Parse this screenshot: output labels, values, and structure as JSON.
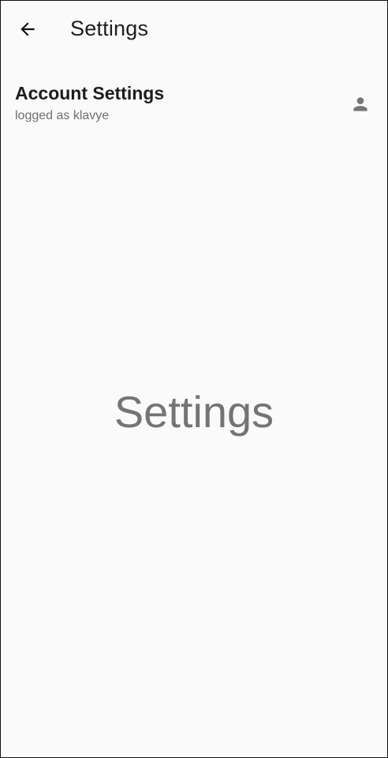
{
  "app_bar": {
    "back_icon": "arrow-back-icon",
    "title": "Settings"
  },
  "account": {
    "title": "Account Settings",
    "subtitle": "logged as klavye",
    "icon": "person-icon"
  },
  "body": {
    "placeholder_text": "Settings"
  },
  "colors": {
    "background": "#fafafa",
    "title_text": "#1e1e1e",
    "muted_text": "#747474",
    "icon": "#757575"
  }
}
